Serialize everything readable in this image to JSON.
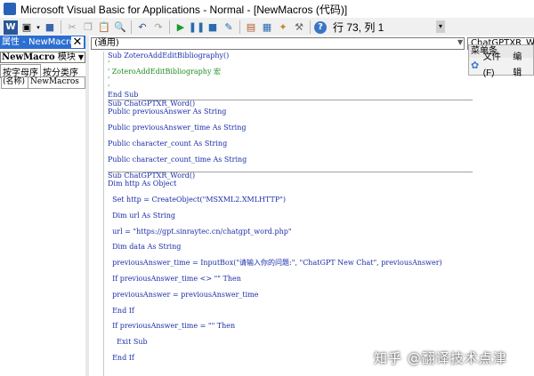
{
  "window": {
    "title": "Microsoft Visual Basic for Applications - Normal - [NewMacros (代码)]"
  },
  "toolbar": {
    "word_icon": "W",
    "status": "行 73, 列 1"
  },
  "properties": {
    "header": "属性 - NewMacros",
    "close_label": "✕",
    "object_name": "NewMacro",
    "object_type": "模块",
    "tab_alpha": "按字母序",
    "tab_category": "按分类序",
    "prop_key": "(名称)",
    "prop_value": "NewMacros"
  },
  "code_window": {
    "object_combo": "(通用)",
    "proc_combo": "ChatGPTXR_W",
    "lines": [
      {
        "t": "Sub ZoteroAddEditBibliography()",
        "k": "code"
      },
      {
        "t": "'",
        "k": "comment"
      },
      {
        "t": "' ZoteroAddEditBibliography 宏",
        "k": "comment"
      },
      {
        "t": "'",
        "k": "comment"
      },
      {
        "t": "'",
        "k": "comment"
      },
      {
        "t": "End Sub",
        "k": "code"
      },
      {
        "t": "Sub ChatGPTXR_Word()",
        "k": "code"
      },
      {
        "t": "Public previousAnswer As String",
        "k": "code"
      },
      {
        "t": "",
        "k": "code"
      },
      {
        "t": "Public previousAnswer_time As String",
        "k": "code"
      },
      {
        "t": "",
        "k": "code"
      },
      {
        "t": "Public character_count As String",
        "k": "code"
      },
      {
        "t": "",
        "k": "code"
      },
      {
        "t": "Public character_count_time As String",
        "k": "code"
      },
      {
        "t": "",
        "k": "code"
      },
      {
        "t": "Sub ChatGPTXR_Word()",
        "k": "code"
      },
      {
        "t": "Dim http As Object",
        "k": "code"
      },
      {
        "t": "",
        "k": "code"
      },
      {
        "t": "  Set http = CreateObject(\"MSXML2.XMLHTTP\")",
        "k": "code"
      },
      {
        "t": "",
        "k": "code"
      },
      {
        "t": "  Dim url As String",
        "k": "code"
      },
      {
        "t": "",
        "k": "code"
      },
      {
        "t": "  url = \"https://gpt.sinraytec.cn/chatgpt_word.php\"",
        "k": "code"
      },
      {
        "t": "",
        "k": "code"
      },
      {
        "t": "  Dim data As String",
        "k": "code"
      },
      {
        "t": "",
        "k": "code"
      },
      {
        "t": "  previousAnswer_time = InputBox(\"请输入你的问题:\", \"ChatGPT New Chat\", previousAnswer)",
        "k": "code"
      },
      {
        "t": "",
        "k": "code"
      },
      {
        "t": "  If previousAnswer_time <> \"\" Then",
        "k": "code"
      },
      {
        "t": "",
        "k": "code"
      },
      {
        "t": "  previousAnswer = previousAnswer_time",
        "k": "code"
      },
      {
        "t": "",
        "k": "code"
      },
      {
        "t": "  End If",
        "k": "code"
      },
      {
        "t": "",
        "k": "code"
      },
      {
        "t": "  If previousAnswer_time = \"\" Then",
        "k": "code"
      },
      {
        "t": "",
        "k": "code"
      },
      {
        "t": "    Exit Sub",
        "k": "code"
      },
      {
        "t": "",
        "k": "code"
      },
      {
        "t": "  End If",
        "k": "code"
      }
    ]
  },
  "context_menu": {
    "header": "菜单条",
    "items": [
      {
        "label": "文件(F)"
      },
      {
        "label": "编辑"
      }
    ]
  },
  "watermark": "知乎 @翻译技术点津",
  "colors": {
    "code_text": "#1a2ea8",
    "comment": "#1e8c1e",
    "panel_header": "#2c6fd1"
  }
}
